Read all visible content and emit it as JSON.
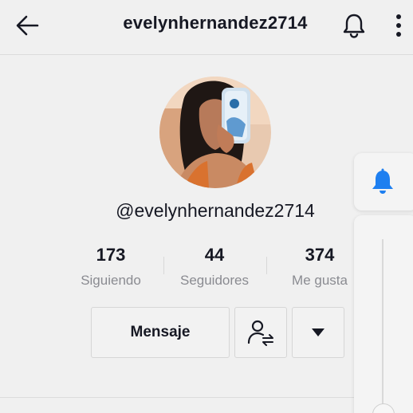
{
  "header": {
    "title": "evelynhernandez2714",
    "back_icon": "arrow-left-icon",
    "bell_icon": "bell-icon",
    "more_icon": "vertical-dots-icon"
  },
  "profile": {
    "handle": "@evelynhernandez2714"
  },
  "stats": [
    {
      "value": "173",
      "label": "Siguiendo"
    },
    {
      "value": "44",
      "label": "Seguidores"
    },
    {
      "value": "374",
      "label": "Me gusta"
    }
  ],
  "actions": {
    "message_label": "Mensaje",
    "follow_icon": "user-swap-icon",
    "dropdown_icon": "triangle-down-icon"
  },
  "side": {
    "bell_icon": "bell-icon",
    "accent": "#1e7ff0"
  }
}
